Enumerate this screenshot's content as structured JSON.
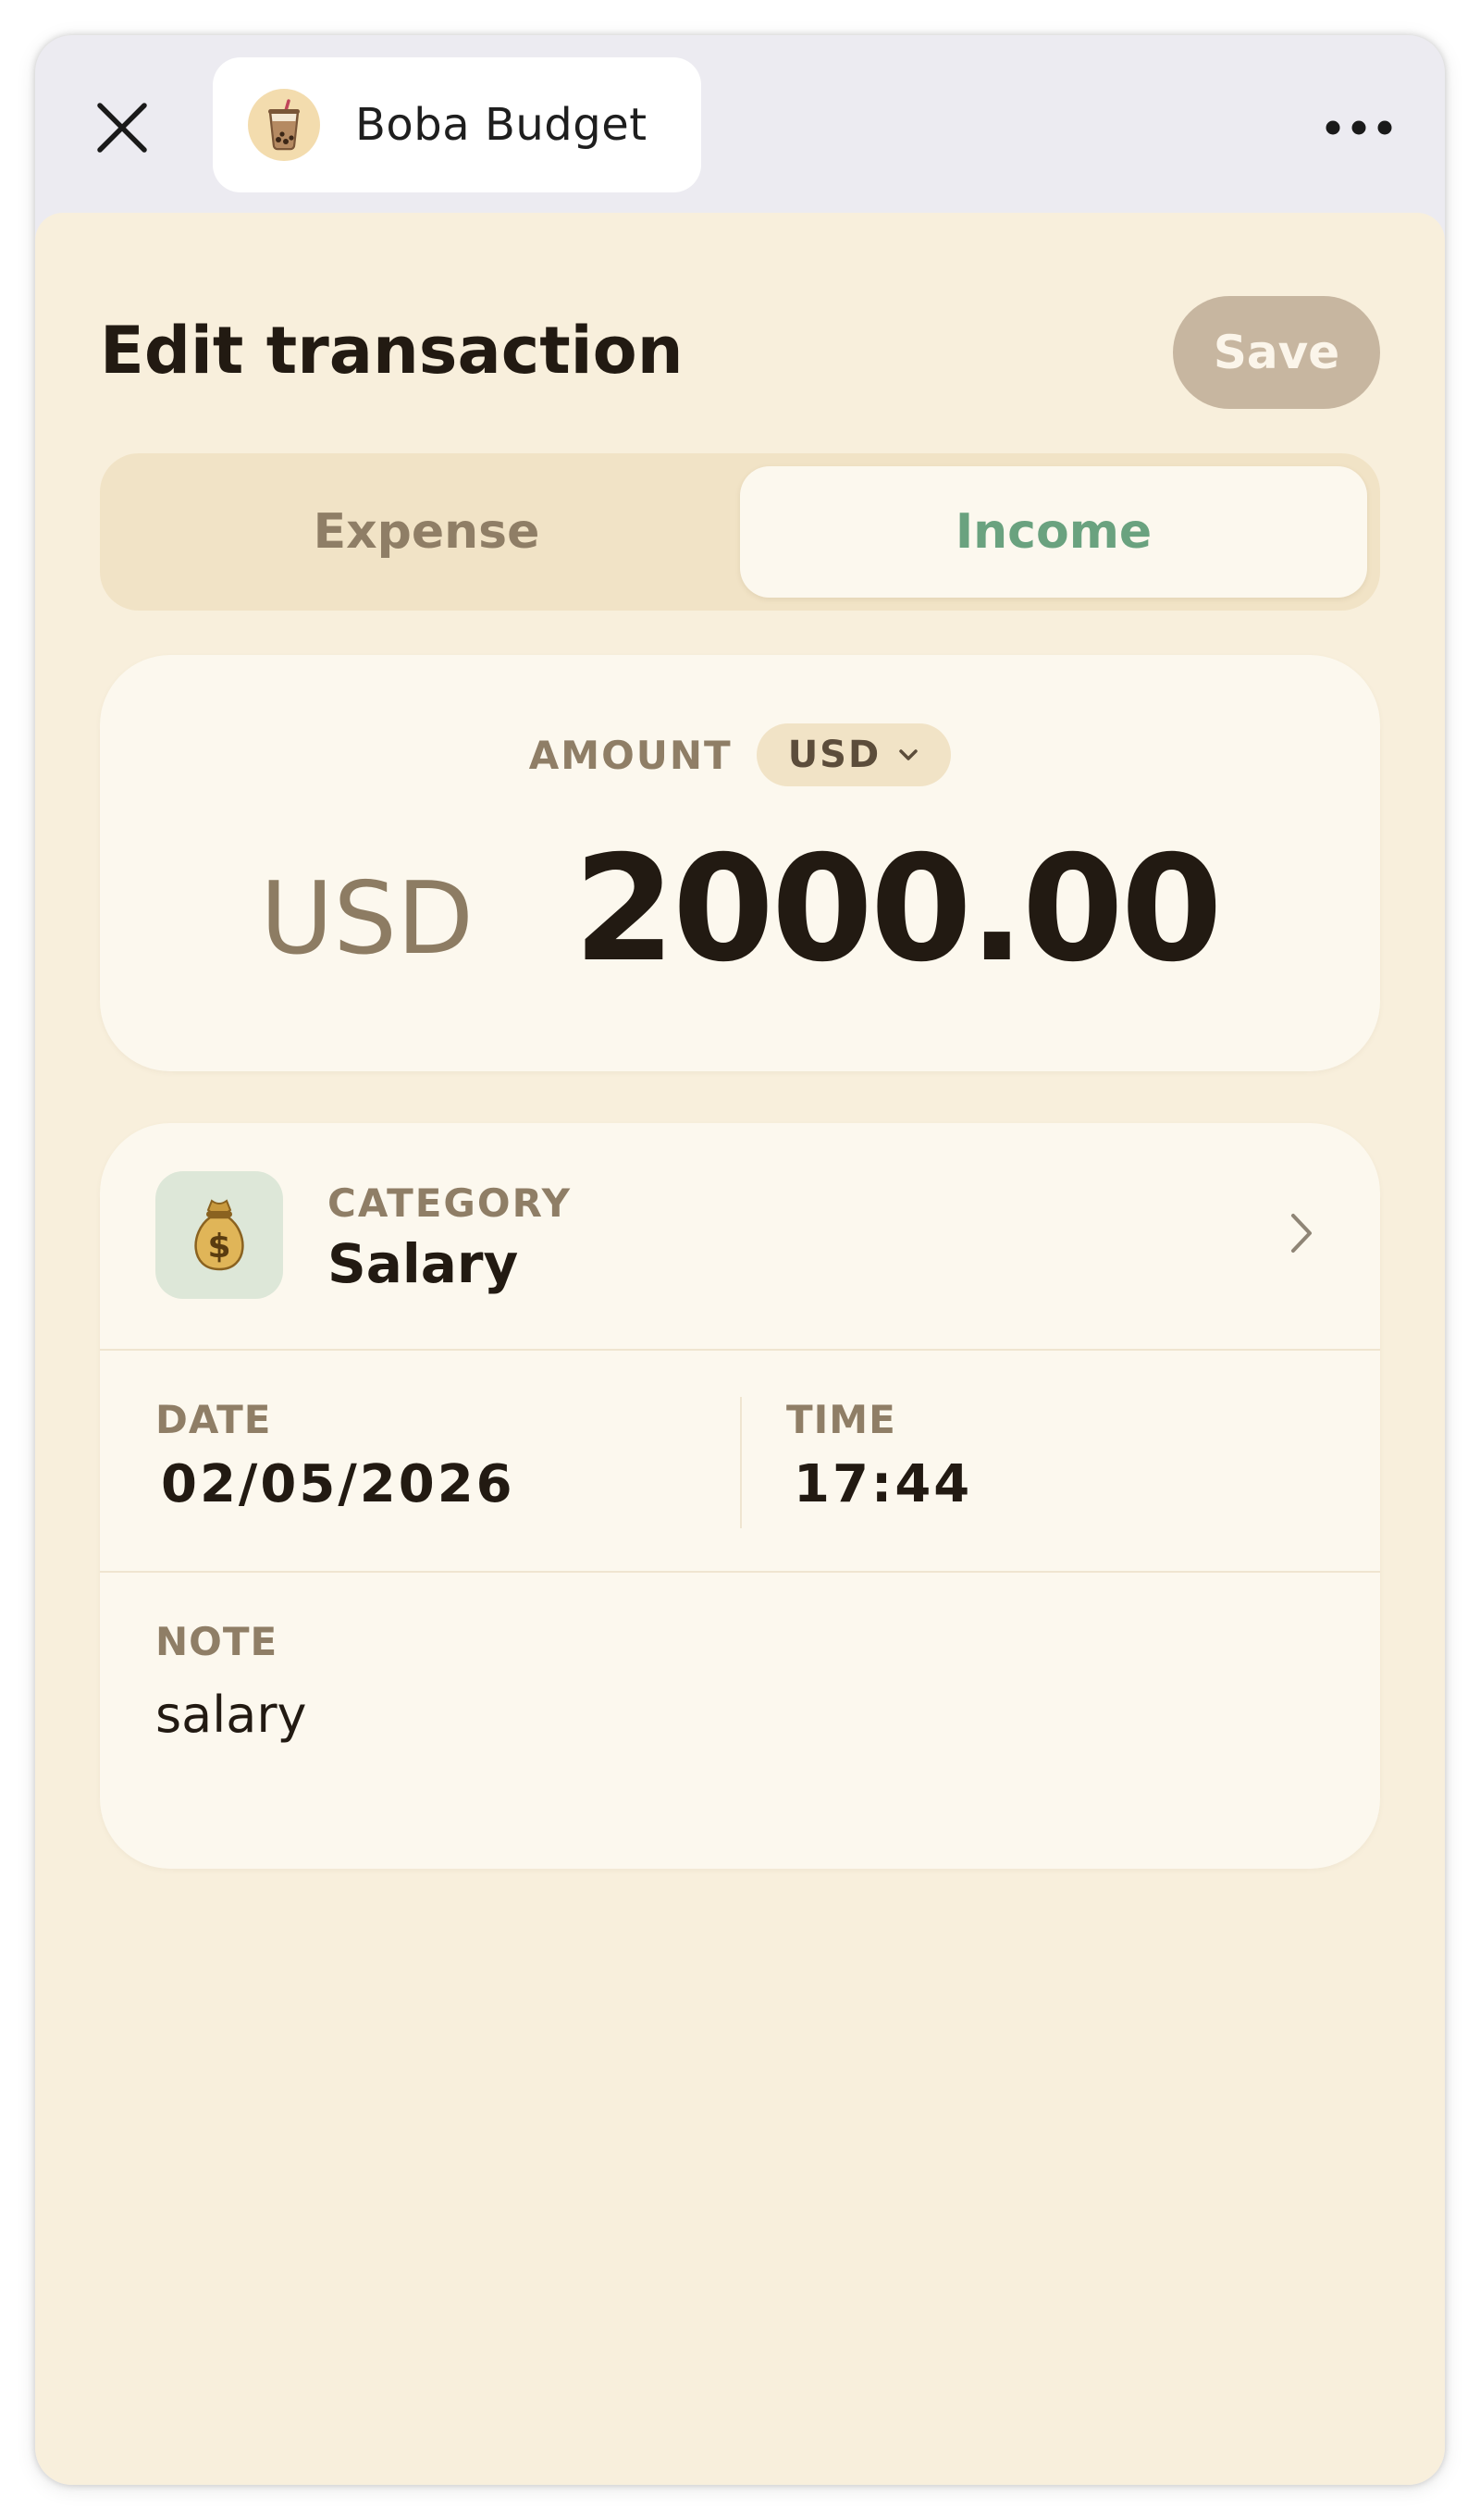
{
  "browser": {
    "app_name": "Boba Budget",
    "icons": {
      "close": "close-icon",
      "logo": "boba-tea-icon",
      "more": "more-horizontal-icon"
    }
  },
  "header": {
    "title": "Edit transaction",
    "save_label": "Save"
  },
  "type_toggle": {
    "options": [
      "Expense",
      "Income"
    ],
    "selected": "Income"
  },
  "amount": {
    "label": "AMOUNT",
    "currency_selector": "USD",
    "currency_prefix": "USD",
    "value": "2000.00"
  },
  "category": {
    "label": "CATEGORY",
    "value": "Salary",
    "icon": "money-bag-icon"
  },
  "date": {
    "label": "DATE",
    "value": "02/05/2026"
  },
  "time": {
    "label": "TIME",
    "value": "17:44"
  },
  "note": {
    "label": "NOTE",
    "value": "salary"
  },
  "colors": {
    "sheet_background": "#f8efdc",
    "card_background": "#fcf8ee",
    "income_accent": "#6aa27f",
    "save_button_disabled": "#c7b6a0",
    "muted_text": "#8f7e66",
    "primary_text": "#221a12"
  }
}
